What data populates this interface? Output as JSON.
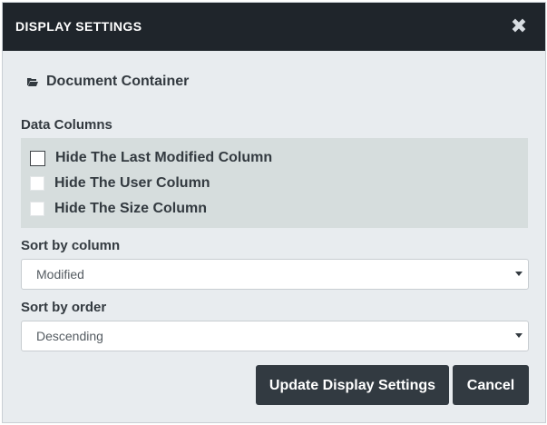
{
  "dialog": {
    "title": "DISPLAY SETTINGS",
    "close_glyph": "✖"
  },
  "folder": {
    "icon": "folder-open-icon",
    "label": "Document Container"
  },
  "data_columns": {
    "label": "Data Columns",
    "options": [
      {
        "label": "Hide The Last Modified Column",
        "checked": false
      },
      {
        "label": "Hide The User Column",
        "checked": false
      },
      {
        "label": "Hide The Size Column",
        "checked": false
      }
    ]
  },
  "sort_column": {
    "label": "Sort by column",
    "value": "Modified"
  },
  "sort_order": {
    "label": "Sort by order",
    "value": "Descending"
  },
  "buttons": {
    "update_label": "Update Display Settings",
    "cancel_label": "Cancel"
  },
  "colors": {
    "header_bg": "#1f252b",
    "dialog_bg": "#e8ecef",
    "panel_bg": "#d6dddd",
    "button_bg": "#323a41",
    "text": "#333a40"
  }
}
